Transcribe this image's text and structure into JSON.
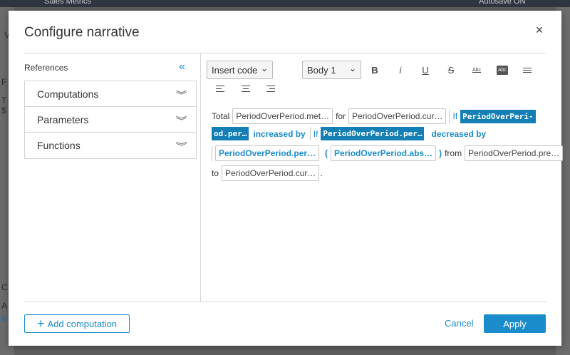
{
  "background": {
    "top_left": "Sales Metrics",
    "top_right": "Autosave ON",
    "frag_1": "V",
    "frag_2": "F",
    "frag_3": "T",
    "frag_4": "$",
    "frag_5": "C",
    "frag_6": "A",
    "frag_7": "e"
  },
  "modal": {
    "title": "Configure narrative",
    "close": "×"
  },
  "references": {
    "label": "References",
    "collapse": "«",
    "items": [
      {
        "label": "Computations"
      },
      {
        "label": "Parameters"
      },
      {
        "label": "Functions"
      }
    ]
  },
  "toolbar": {
    "insert_code": "Insert code",
    "style": "Body 1",
    "bold": "B",
    "italic": "i",
    "underline": "U",
    "strike": "S",
    "abc": "Abc",
    "abc_boxed": "Abc"
  },
  "narrative": {
    "total": "Total",
    "metric_chip": "PeriodOverPeriod.met…",
    "for": "for",
    "current_chip": "PeriodOverPeriod.cur…",
    "if1": "If",
    "hl1a": "PeriodOverPeri-",
    "hl1b": "od.per…",
    "increased_by": "increased by",
    "if2": "If",
    "hl2": "PeriodOverPeriod.per…",
    "decreased_by": "decreased by",
    "percent_chip": "PeriodOverPeriod.per…",
    "open_paren": "(",
    "abs_chip": "PeriodOverPeriod.abs…",
    "close_paren": ")",
    "from": "from",
    "previous_chip": "PeriodOverPeriod.pre…",
    "to": "to",
    "current_chip2": "PeriodOverPeriod.cur…",
    "period": "."
  },
  "footer": {
    "add_plus": "+",
    "add_label": "Add computation",
    "cancel": "Cancel",
    "apply": "Apply"
  }
}
